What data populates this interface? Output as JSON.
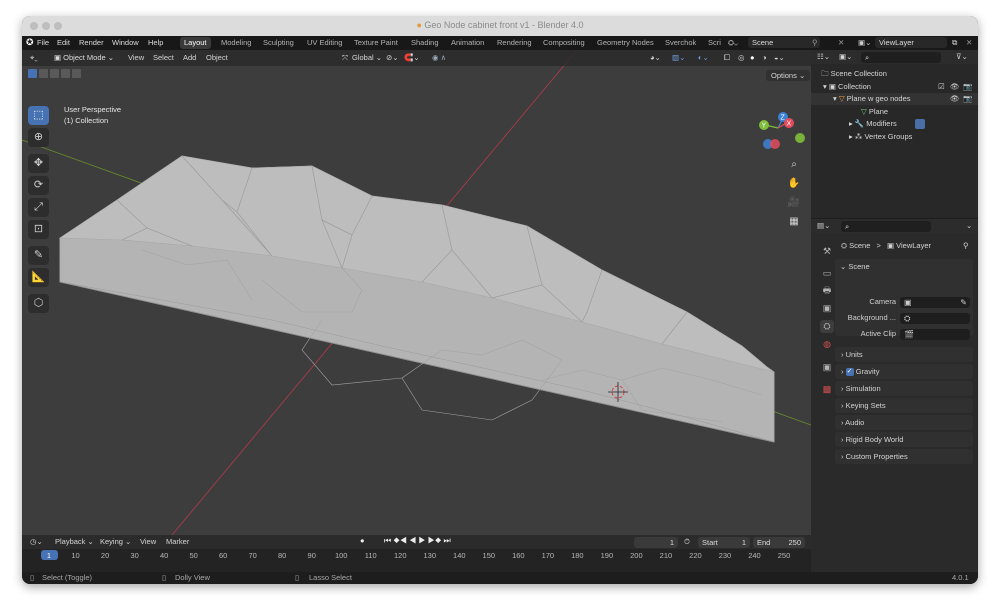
{
  "window": {
    "title": "Geo Node cabinet front v1 - Blender 4.0"
  },
  "menu": [
    "File",
    "Edit",
    "Render",
    "Window",
    "Help"
  ],
  "workspaces": [
    "Layout",
    "Modeling",
    "Sculpting",
    "UV Editing",
    "Texture Paint",
    "Shading",
    "Animation",
    "Rendering",
    "Compositing",
    "Geometry Nodes",
    "Sverchok",
    "Scri"
  ],
  "scene_field": "Scene",
  "viewlayer_field": "ViewLayer",
  "viewport": {
    "mode": "Object Mode",
    "menus": [
      "View",
      "Select",
      "Add",
      "Object"
    ],
    "orientation": "Global",
    "options_label": "Options",
    "overlay_line1": "User Perspective",
    "overlay_line2": "(1) Collection",
    "gizmo_axes": [
      "X",
      "Y",
      "Z"
    ]
  },
  "outliner": {
    "rows": [
      "Scene Collection",
      "Collection",
      "Plane w geo nodes",
      "Plane",
      "Modifiers",
      "Vertex Groups"
    ]
  },
  "properties": {
    "breadcrumb_scene": "Scene",
    "breadcrumb_sep": ">",
    "breadcrumb_layer": "ViewLayer",
    "section_scene": "Scene",
    "camera_label": "Camera",
    "background_label": "Background ...",
    "activeclip_label": "Active Clip",
    "sections": [
      "Units",
      "Gravity",
      "Simulation",
      "Keying Sets",
      "Audio",
      "Rigid Body World",
      "Custom Properties"
    ],
    "gravity_checked": true
  },
  "timeline": {
    "menus": [
      "Playback",
      "Keying",
      "View",
      "Marker"
    ],
    "current_frame": "1",
    "start_label": "Start",
    "start_value": "1",
    "end_label": "End",
    "end_value": "250",
    "ticks": [
      "1",
      "10",
      "20",
      "30",
      "40",
      "50",
      "60",
      "70",
      "80",
      "90",
      "100",
      "110",
      "120",
      "130",
      "140",
      "150",
      "160",
      "170",
      "180",
      "190",
      "200",
      "210",
      "220",
      "230",
      "240",
      "250"
    ]
  },
  "status": {
    "items": [
      "Select (Toggle)",
      "Dolly View",
      "Lasso Select"
    ],
    "version": "4.0.1"
  },
  "colors": {
    "accent": "#4772b3",
    "x_axis": "#e24b5c",
    "y_axis": "#7fbe3a",
    "z_axis": "#3c81d6",
    "object_orange": "#f0a03c"
  }
}
